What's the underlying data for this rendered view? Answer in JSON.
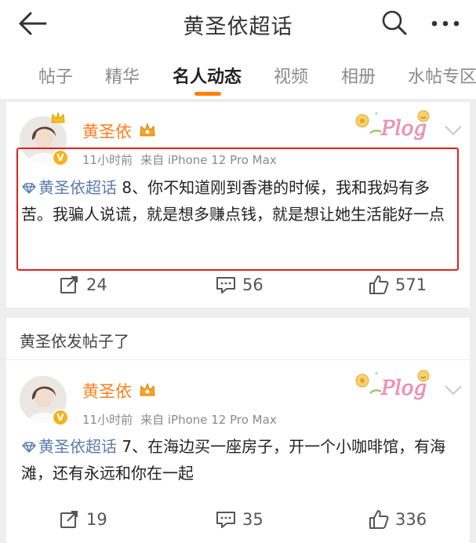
{
  "header": {
    "title": "黄圣依超话",
    "icons": [
      "back-arrow-icon",
      "search-icon",
      "more-icon"
    ]
  },
  "tabs": [
    {
      "label": "帖子",
      "active": false
    },
    {
      "label": "精华",
      "active": false
    },
    {
      "label": "名人动态",
      "active": true
    },
    {
      "label": "视频",
      "active": false
    },
    {
      "label": "相册",
      "active": false
    },
    {
      "label": "水帖专区",
      "active": false
    }
  ],
  "colors": {
    "accent": "#ff8200",
    "username": "#ff7e1d",
    "topic": "#5b7cae",
    "highlight_box": "#e02020"
  },
  "posts": [
    {
      "section_title": "",
      "author": "黄圣依",
      "time": "11小时前",
      "source": "来自 iPhone 12 Pro Max",
      "topic": "黄圣依超话",
      "text": " 8、你不知道刚到香港的时候，我和我妈有多苦。我骗人说谎，就是想多赚点钱，就是想让她生活能好一点",
      "reposts": "24",
      "comments": "56",
      "likes": "571",
      "highlighted": true
    },
    {
      "section_title": "黄圣依发帖子了",
      "author": "黄圣依",
      "time": "11小时前",
      "source": "来自 iPhone 12 Pro Max",
      "topic": "黄圣依超话",
      "text": " 7、在海边买一座房子，开一个小咖啡馆，有海滩，还有永远和你在一起",
      "reposts": "19",
      "comments": "35",
      "likes": "336",
      "highlighted": false
    }
  ]
}
